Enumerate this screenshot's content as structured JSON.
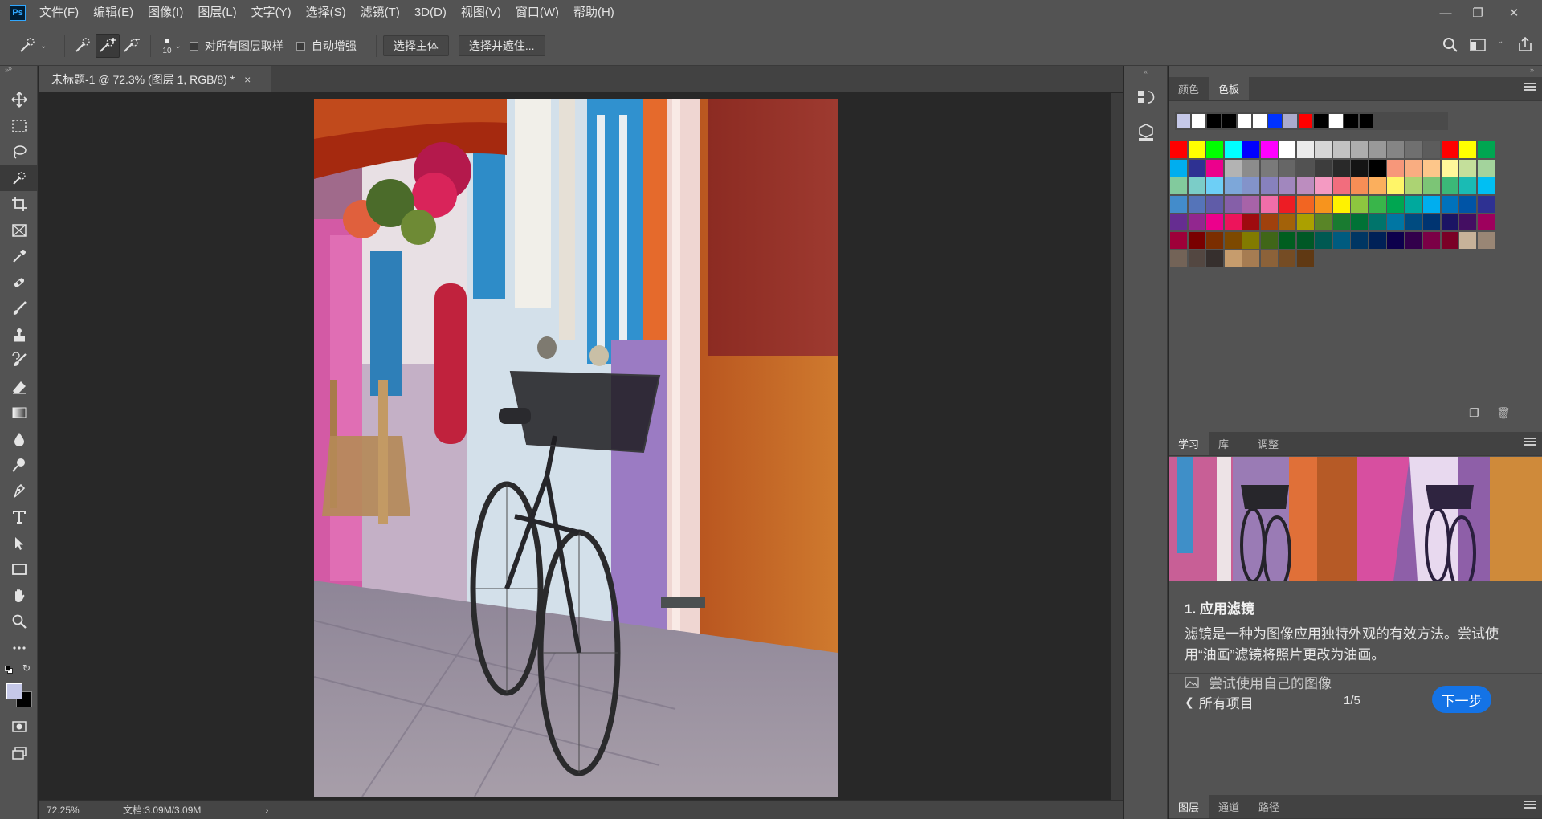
{
  "app": {
    "logo": "Ps"
  },
  "menu": [
    "文件(F)",
    "编辑(E)",
    "图像(I)",
    "图层(L)",
    "文字(Y)",
    "选择(S)",
    "滤镜(T)",
    "3D(D)",
    "视图(V)",
    "窗口(W)",
    "帮助(H)"
  ],
  "options": {
    "brush_size": "10",
    "sample_all_layers": "对所有图层取样",
    "auto_enhance": "自动增强",
    "select_subject": "选择主体",
    "select_and_mask": "选择并遮住..."
  },
  "document": {
    "tab_title": "未标题-1 @ 72.3% (图层 1, RGB/8) *",
    "close": "×"
  },
  "status": {
    "zoom": "72.25%",
    "doc_size": "文档:3.09M/3.09M",
    "arrow": "›"
  },
  "swatches_panel": {
    "tabs": [
      "颜色",
      "色板"
    ],
    "active_tab": 1,
    "recent": [
      "#c5c8e8",
      "#ffffff",
      "#000000",
      "#000000",
      "#ffffff",
      "#ffffff",
      "#0032ff",
      "#aaaacc",
      "#ff0000",
      "#000000",
      "#ffffff",
      "#000000",
      "#000000"
    ],
    "grid": [
      [
        "#ff0000",
        "#ffff00",
        "#00ff00",
        "#00ffff",
        "#0000ff",
        "#ff00ff",
        "#ffffff",
        "#ebebeb",
        "#d6d6d6",
        "#c2c2c2",
        "#adadad",
        "#999999",
        "#858585",
        "#707070",
        "#5c5c5c",
        "#ff0000",
        "#ffff00",
        "#00a651"
      ],
      [
        "#00aeef",
        "#2e3192",
        "#ec008c",
        "#b3b3b3",
        "#8c8c8c",
        "#7a7a7a",
        "#666666",
        "#525252",
        "#3d3d3d",
        "#292929",
        "#141414",
        "#000000",
        "#f7977a",
        "#f9ad81",
        "#fdc68a",
        "#fff79a",
        "#c4df9b",
        "#a3d39c"
      ],
      [
        "#82ca9d",
        "#7bcdc8",
        "#6dcff6",
        "#7da7d9",
        "#8393ca",
        "#8781bd",
        "#a187be",
        "#bc8dbf",
        "#f49ac2",
        "#f26d7d",
        "#f68e56",
        "#fbaf5d",
        "#fff568",
        "#acd373",
        "#7cc576",
        "#3bb878",
        "#1abbb4",
        "#00bff3"
      ],
      [
        "#438ccb",
        "#5574b9",
        "#605ca8",
        "#855fa8",
        "#a763a8",
        "#f06ea9",
        "#ed1c24",
        "#f26522",
        "#f7941d",
        "#fff200",
        "#8dc63f",
        "#39b54a",
        "#00a651",
        "#00a99d",
        "#00aeef",
        "#0072bc",
        "#0054a6",
        "#2e3192"
      ],
      [
        "#662d91",
        "#92278f",
        "#ec008c",
        "#ed145b",
        "#9e0b0f",
        "#a0410d",
        "#a36209",
        "#aba000",
        "#598527",
        "#197b30",
        "#007236",
        "#00746b",
        "#0076a3",
        "#004b80",
        "#003471",
        "#1b1464",
        "#440e62",
        "#9e005d"
      ],
      [
        "#9e0039",
        "#790000",
        "#7b2e00",
        "#7d4900",
        "#827b00",
        "#406618",
        "#005e20",
        "#005826",
        "#005952",
        "#005b7f",
        "#003663",
        "#002157",
        "#0d004c",
        "#32004b",
        "#7b0046",
        "#7a0026",
        "#c7b299",
        "#998675"
      ],
      [
        "#736357",
        "#534741",
        "#362f2d",
        "#c69c6d",
        "#a67c52",
        "#8c6239",
        "#754c24",
        "#603913"
      ]
    ]
  },
  "learn_panel": {
    "tabs": [
      "学习",
      "库",
      "调整"
    ],
    "active_tab": 0,
    "step_title": "1. 应用滤镜",
    "description": "滤镜是一种为图像应用独特外观的有效方法。尝试使用“油画”滤镜将照片更改为油画。",
    "try_own": "尝试使用自己的图像",
    "back": "所有项目",
    "progress": "1/5",
    "next": "下一步"
  },
  "layers_panel": {
    "tabs": [
      "图层",
      "通道",
      "路径"
    ],
    "active_tab": 0
  },
  "colors": {
    "accent": "#1473e6",
    "foreground": "#c5c8e8",
    "background": "#000000"
  }
}
